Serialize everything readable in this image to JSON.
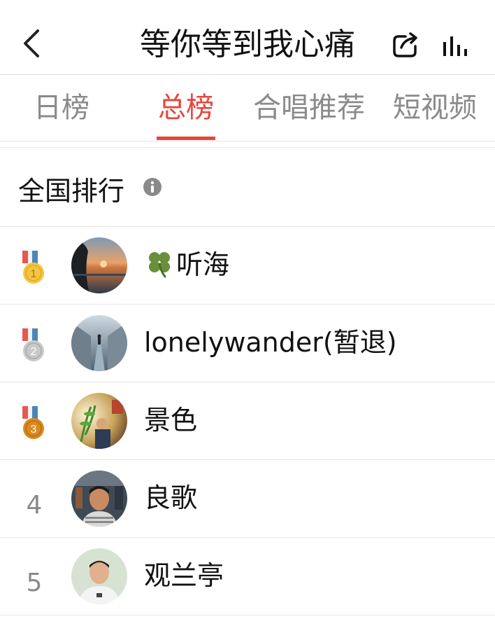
{
  "header": {
    "title": "等你等到我心痛",
    "icons": {
      "back": "chevron-left-icon",
      "share": "share-icon",
      "stats": "bar-chart-icon"
    }
  },
  "tabs": [
    {
      "label": "日榜",
      "active": false
    },
    {
      "label": "总榜",
      "active": true
    },
    {
      "label": "合唱推荐",
      "active": false
    },
    {
      "label": "短视频",
      "active": false
    }
  ],
  "section": {
    "title": "全国排行",
    "info_icon": "info-icon"
  },
  "colors": {
    "accent": "#e8453c",
    "gold": "#f4c542",
    "silver": "#c9c9c9",
    "bronze": "#d98a1e",
    "ribbon_red": "#e8574f",
    "ribbon_blue": "#4a86b8"
  },
  "ranking": [
    {
      "rank": "1",
      "name": "听海",
      "name_prefix_icon": "four-leaf-clover-icon",
      "medal": "gold-medal-icon"
    },
    {
      "rank": "2",
      "name": "lonelywander(暂退)",
      "medal": "silver-medal-icon"
    },
    {
      "rank": "3",
      "name": "景色",
      "medal": "bronze-medal-icon"
    },
    {
      "rank": "4",
      "name": "良歌"
    },
    {
      "rank": "5",
      "name": "观兰亭"
    }
  ]
}
